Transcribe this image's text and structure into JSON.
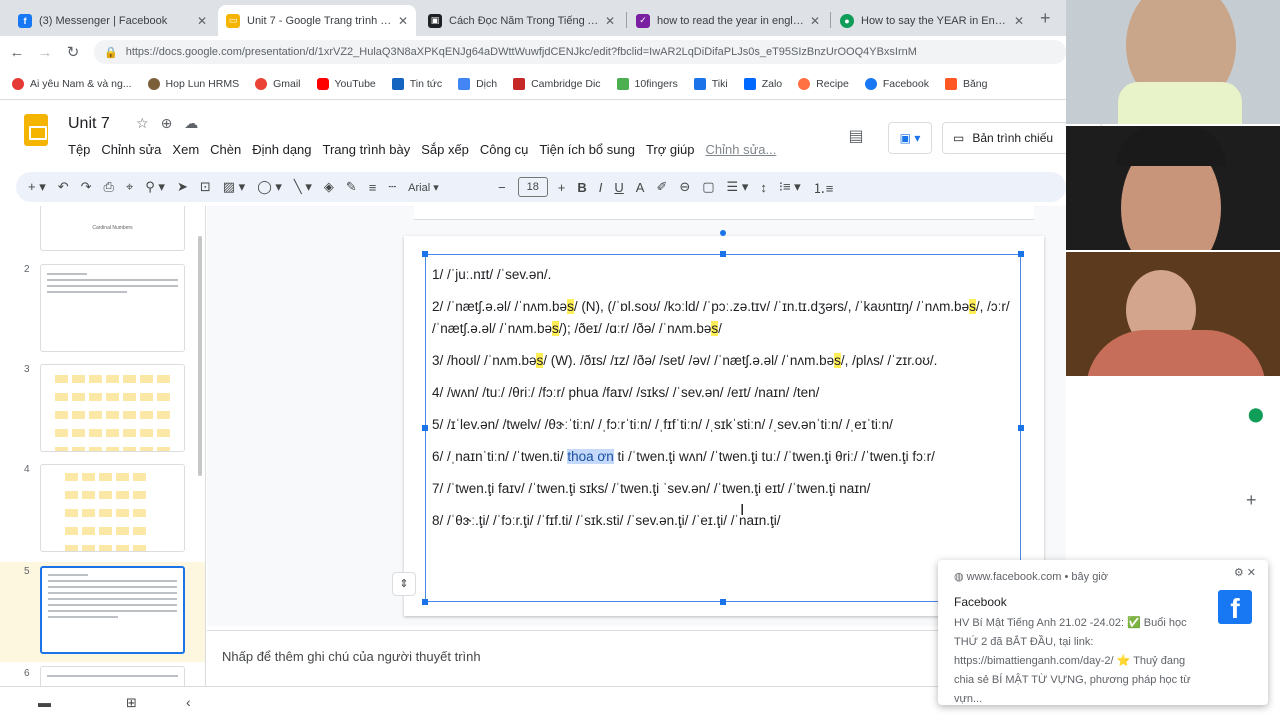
{
  "browser": {
    "tabs": [
      {
        "title": "(3) Messenger | Facebook",
        "icon": "facebook-icon",
        "color": "#1877f2"
      },
      {
        "title": "Unit 7 - Google Trang trình bày",
        "icon": "slides-icon",
        "color": "#f4b400"
      },
      {
        "title": "Cách Đọc Năm Trong Tiếng Anh",
        "icon": "article-icon",
        "color": "#202124"
      },
      {
        "title": "how to read the year in english",
        "icon": "quiz-icon",
        "color": "#7b1fa2"
      },
      {
        "title": "How to say the YEAR in English",
        "icon": "video-icon",
        "color": "#0f9d58"
      }
    ],
    "url": "https://docs.google.com/presentation/d/1xrVZ2_HulaQ3N8aXPKqENJg64aDWttWuwfjdCENJkc/edit?fbclid=IwAR2LqDiDifaPLJs0s_eT95SIzBnzUrOOQ4YBxsIrnM",
    "bookmarks": [
      "Ai yêu Nam & và ng...",
      "Hop Lun HRMS",
      "Gmail",
      "YouTube",
      "Tin tức",
      "Dịch",
      "Cambridge Dic",
      "10fingers",
      "Tiki",
      "Zalo",
      "Recipe",
      "Facebook",
      "Băng"
    ]
  },
  "doc": {
    "title": "Unit 7",
    "menu": [
      "Tệp",
      "Chỉnh sửa",
      "Xem",
      "Chèn",
      "Định dạng",
      "Trang trình bày",
      "Sắp xếp",
      "Công cụ",
      "Tiện ích bổ sung",
      "Trợ giúp",
      "Chỉnh sửa..."
    ],
    "present_label": "Bản trình chiếu",
    "font": "Arial",
    "font_size": "18",
    "notes_placeholder": "Nhấp để thêm ghi chú của người thuyết trình"
  },
  "filmstrip": {
    "slides": [
      "2",
      "3",
      "4",
      "5",
      "6"
    ],
    "top_caption": "Cardinal Numbers"
  },
  "slide_lines": [
    {
      "a": "1/ /ˈjuː.nɪt/ /ˈsev.ən/."
    },
    {
      "a": "2/ /ˈnætʃ.ə.əl/ /ˈnʌm.bə",
      "h": "s",
      "b": "/ (N), (/ˈɒl.soʊ/ /kɔːld/ /ˈpɔː.zə.tɪv/ /ˈɪn.tɪ.dʒərs/, /ˈkaʊntɪŋ/ /ˈnʌm.bə",
      "h2": "s",
      "c": "/, /ɔːr/ /ˈnætʃ.ə.əl/ /ˈnʌm.bə",
      "h3": "s",
      "d": "/); /ðeɪ/ /ɑːr/ /ðə/ /ˈnʌm.bə",
      "h4": "s",
      "e": "/"
    },
    {
      "a": "3/ /hoʊl/ /ˈnʌm.bə",
      "h": "s",
      "b": "/ (W). /ðɪs/ /ɪz/ /ðə/ /set/ /əv/ /ˈnætʃ.ə.əl/ /ˈnʌm.bə",
      "h2": "s",
      "c": "/, /plʌs/ /ˈzɪr.oʊ/."
    },
    {
      "a": "4/ /wʌn/ /tuː/ /θriː/ /fɔːr/ phua /faɪv/ /sɪks/ /ˈsev.ən/ /eɪt/ /naɪn/ /ten/"
    },
    {
      "a": "5/ /ɪˈlev.ən/ /twelv/ /θɝːˈtiːn/ /ˌfɔːrˈtiːn/ /ˌfɪfˈtiːn/ /ˌsɪkˈstiːn/  /ˌsev.ənˈtiːn/ /ˌeɪˈtiːn/"
    },
    {
      "a": "6/ /ˌnaɪnˈtiːn/ /ˈtwen.ti/ ",
      "sel": "thoa ơn",
      "b": " ti /ˈtwen.ţi wʌn/ /ˈtwen.ţi tuː/ /ˈtwen.ţi θriː/ /ˈtwen.ţi fɔːr/"
    },
    {
      "a": "7/ /ˈtwen.ţi faɪv/ /ˈtwen.ţi sɪks/ /ˈtwen.ţi ˈsev.ən/ /ˈtwen.ţi eɪt/ /ˈtwen.ţi naɪn/"
    },
    {
      "a": "8/ /ˈθɝː.ţi/ /ˈfɔːr.ţi/ /ˈfɪf.ti/ /ˈsɪk.sti/ /ˈsev.ən.ţi/ /ˈeɪ.ţi/ /ˈnaɪn.ţi/"
    }
  ],
  "notification": {
    "source": "www.facebook.com • bây giờ",
    "from": "Facebook",
    "body": "HV Bí Mật Tiếng Anh 21.02 -24.02: ✅ Buổi học THỨ 2 đã BẮT ĐẦU, tại link: https://bimattienganh.com/day-2/ ⭐ Thuỷ đang chia sẻ BÍ MẬT TỪ VỰNG, phương pháp học từ vựn..."
  },
  "colors": {
    "accent": "#1a73e8",
    "highlight": "#ffee58",
    "slides_yellow": "#f4b400"
  }
}
